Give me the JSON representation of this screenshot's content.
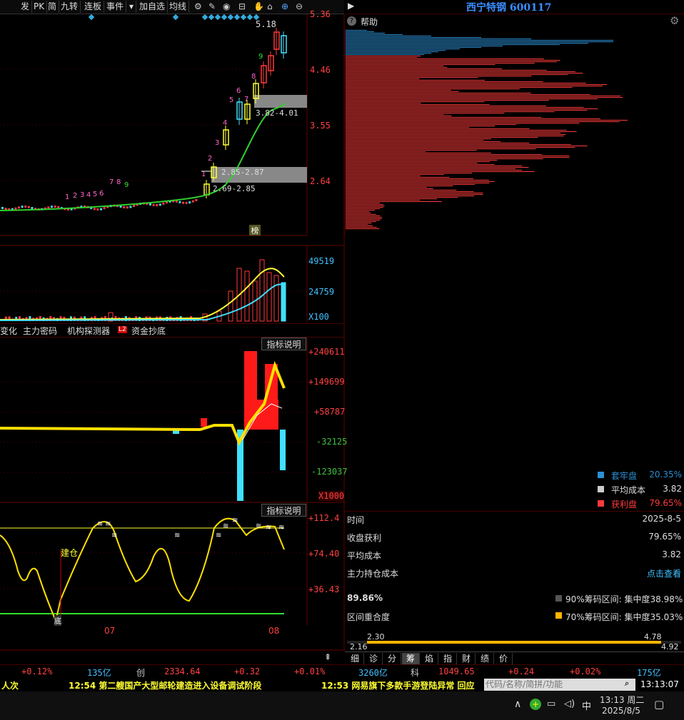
{
  "toolbar": {
    "items": [
      "发",
      "PK",
      "简",
      "九转",
      "连板",
      "事件",
      "▾",
      "加自选",
      "均线"
    ]
  },
  "stock": {
    "name": "西宁特钢",
    "code": "600117"
  },
  "help_label": "帮助",
  "main_chart": {
    "price_ticks": [
      "5.36",
      "4.46",
      "3.55",
      "2.64"
    ],
    "high_label": "5.18",
    "zone_labels": [
      "3.82-4.01",
      "2.85-2.87",
      "2.69-2.85"
    ],
    "nine_counts_a": [
      "1",
      "2",
      "3",
      "4",
      "5",
      "6",
      "7",
      "8",
      "9"
    ],
    "nine_counts_b": [
      "1",
      "2",
      "3",
      "4",
      "5",
      "6",
      "7",
      "8",
      "9"
    ],
    "badge": "榜"
  },
  "volume_chart": {
    "ticks": [
      "49519",
      "24759",
      "X100"
    ]
  },
  "indicator_tabs": [
    "变化",
    "主力密码",
    "机构探测器",
    "L2",
    "资金抄底"
  ],
  "fund_chart": {
    "explain_label": "指标说明",
    "ticks": [
      "+240611",
      "+149699",
      "+58787",
      "-32125",
      "-123037",
      "X1000"
    ]
  },
  "kdj_chart": {
    "explain_label": "指标说明",
    "ticks": [
      "+112.4",
      "+74.40",
      "+36.43"
    ],
    "build_label": "建仓",
    "low_label": "底"
  },
  "date_axis": {
    "labels": [
      "07",
      "08"
    ]
  },
  "chip_stats": {
    "legend": [
      {
        "label": "套牢盘",
        "value": "20.35%",
        "color": "#2b8fd4"
      },
      {
        "label": "平均成本",
        "value": "3.82",
        "color": "#cccccc"
      },
      {
        "label": "获利盘",
        "value": "79.65%",
        "color": "#ff3b3b"
      }
    ],
    "rows": [
      {
        "k": "时间",
        "v": "2025-8-5"
      },
      {
        "k": "收盘获利",
        "v": "79.65%"
      },
      {
        "k": "平均成本",
        "v": "3.82"
      },
      {
        "k": "主力持仓成本",
        "v": "点击查看"
      }
    ],
    "concentration_pct": "89.86%",
    "overlap_label": "区间重合度",
    "range90": "90%筹码区间: 集中度38.98%",
    "range70": "70%筹码区间: 集中度35.03%",
    "bar_labels": {
      "tl": "2.30",
      "tr": "4.78",
      "bl": "2.16",
      "br": "4.92"
    }
  },
  "right_tabs": [
    "细",
    "诊",
    "分",
    "筹",
    "焰",
    "指",
    "财",
    "绩",
    "价"
  ],
  "status_bar": {
    "items": [
      {
        "t": "+0.12%",
        "c": "#ff4040"
      },
      {
        "t": "135亿",
        "c": "#40c0ff"
      },
      {
        "t": "创",
        "c": "#ccc"
      },
      {
        "t": "2334.64",
        "c": "#ff4040"
      },
      {
        "t": "+0.32",
        "c": "#ff4040"
      },
      {
        "t": "+0.01%",
        "c": "#ff4040"
      },
      {
        "t": "3260亿",
        "c": "#40c0ff"
      },
      {
        "t": "科",
        "c": "#ccc"
      },
      {
        "t": "1049.65",
        "c": "#ff4040"
      },
      {
        "t": "+0.24",
        "c": "#ff4040"
      },
      {
        "t": "+0.02%",
        "c": "#ff4040"
      },
      {
        "t": "175亿",
        "c": "#40c0ff"
      }
    ]
  },
  "news": {
    "prefix": "人次",
    "item1": "12:54 第二艘国产大型邮轮建造进入设备调试阶段",
    "item2": "12:53 网易旗下多款手游登陆异常 回应",
    "search_placeholder": "代码/名称/简拼/功能",
    "clock": "13:13:07"
  },
  "taskbar": {
    "time": "13:13 周二",
    "date": "2025/8/5",
    "ime": "中"
  }
}
